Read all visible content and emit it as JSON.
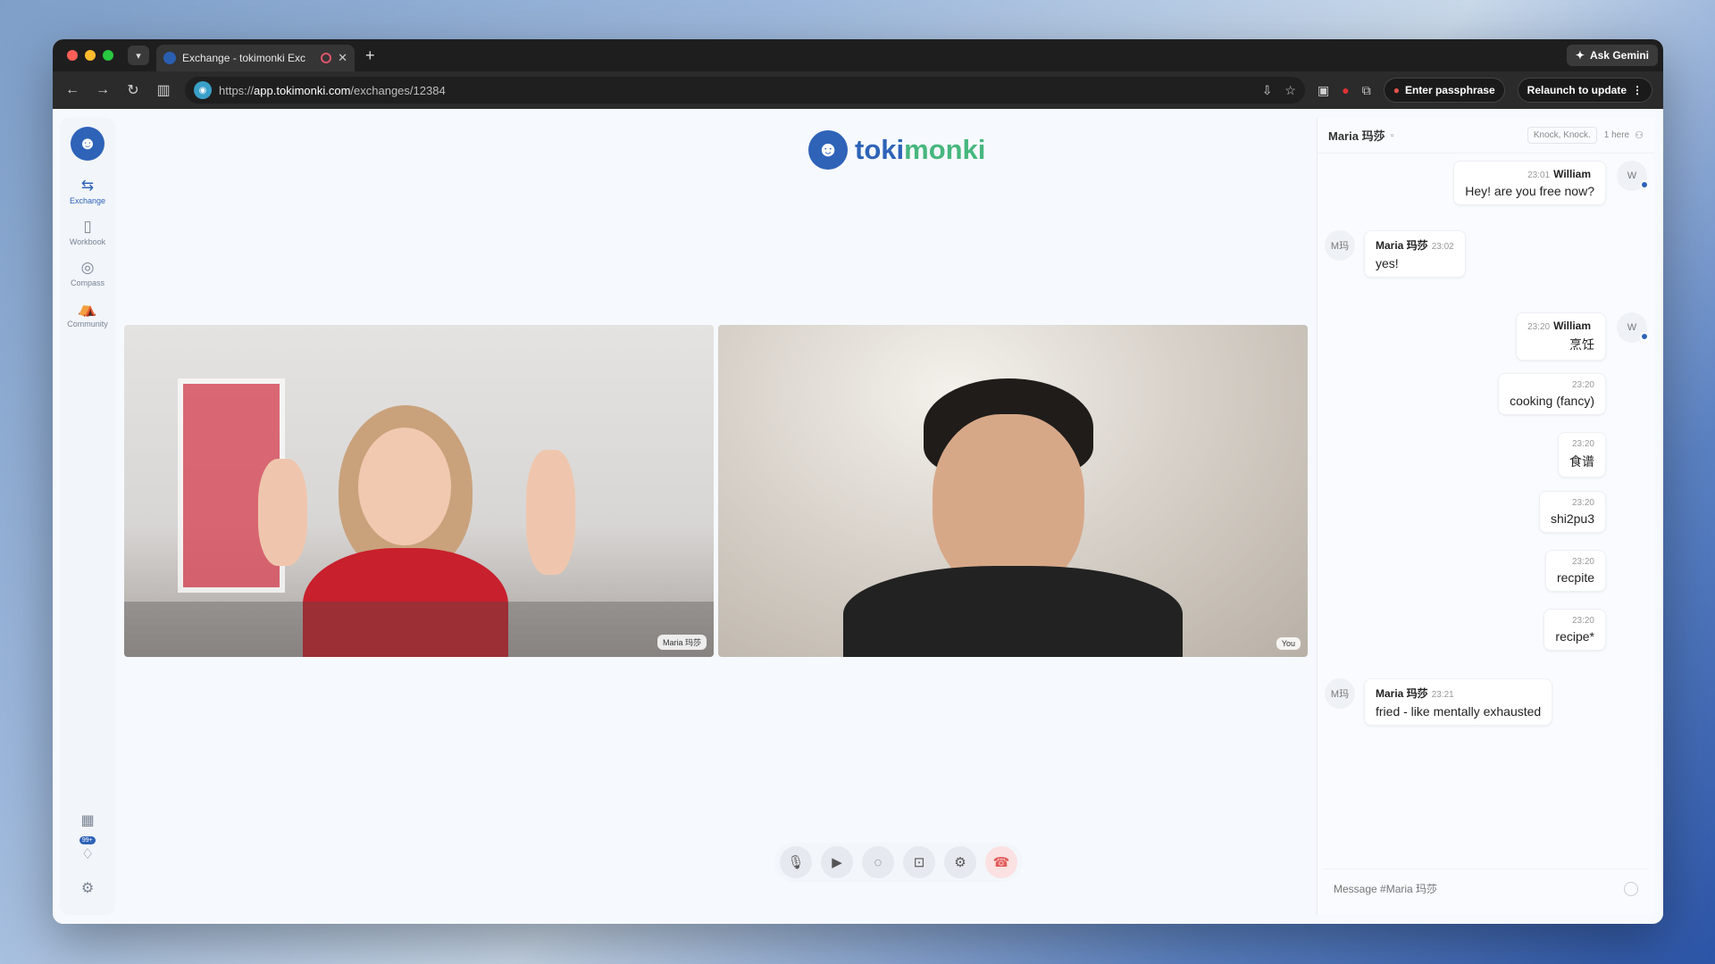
{
  "browser": {
    "tab_title": "Exchange - tokimonki Exc",
    "url_prefix": "https://",
    "url_domain": "app.tokimonki.com",
    "url_path": "/exchanges/12384",
    "ask_gemini": "Ask Gemini",
    "enter_passphrase": "Enter passphrase",
    "relaunch": "Relaunch to update"
  },
  "sidebar": {
    "items": [
      {
        "label": "Exchange",
        "icon": "exchange-icon"
      },
      {
        "label": "Workbook",
        "icon": "book-icon"
      },
      {
        "label": "Compass",
        "icon": "compass-icon"
      },
      {
        "label": "Community",
        "icon": "community-icon"
      }
    ],
    "badge": "99+"
  },
  "brand": {
    "part1": "toki",
    "part2": "monki"
  },
  "videos": {
    "left_name": "Maria 玛莎",
    "right_name": "You"
  },
  "chat": {
    "title": "Maria 玛莎",
    "knock": "Knock, Knock.",
    "here": "1 here",
    "messages": [
      {
        "time": "23:01",
        "author": "William",
        "text": "Hey! are you free now?"
      },
      {
        "author": "Maria 玛莎",
        "time": "23:02",
        "text": "yes!"
      },
      {
        "time": "23:20",
        "author": "William",
        "text": "烹饪"
      },
      {
        "time": "23:20",
        "text": "cooking (fancy)"
      },
      {
        "time": "23:20",
        "text": "食谱"
      },
      {
        "time": "23:20",
        "text": "shi2pu3"
      },
      {
        "time": "23:20",
        "text": "recpite"
      },
      {
        "time": "23:20",
        "text": "recipe*"
      },
      {
        "author": "Maria 玛莎",
        "time": "23:21",
        "text": "fried - like mentally exhausted"
      }
    ],
    "avatar_w": "W",
    "avatar_m": "M玛",
    "placeholder": "Message #Maria 玛莎"
  },
  "colors": {
    "accent": "#2e63b8",
    "brand_green": "#47b77e",
    "hangup": "#e25a5a"
  }
}
